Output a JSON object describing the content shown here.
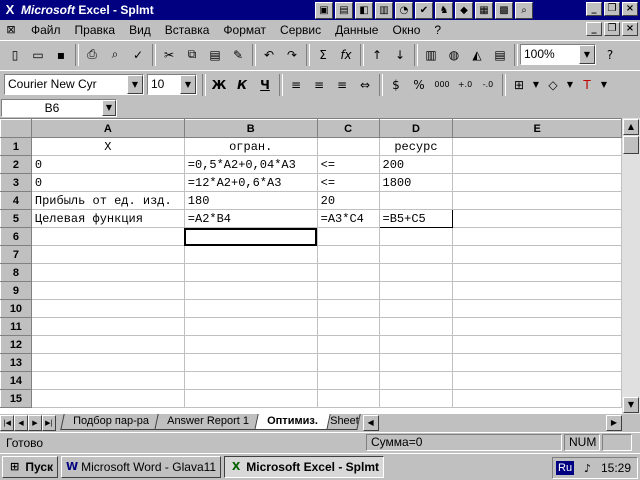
{
  "window": {
    "title_brand": "Microsoft",
    "title_rest": " Excel - Splmt",
    "app_icon": "excel-x-icon",
    "buttons": [
      "_",
      "❐",
      "×"
    ]
  },
  "menu": {
    "items": [
      "Файл",
      "Правка",
      "Вид",
      "Вставка",
      "Формат",
      "Сервис",
      "Данные",
      "Окно",
      "?"
    ]
  },
  "toolbar1": {
    "zoom": "100%"
  },
  "toolbar2": {
    "font_name": "Courier New Cyr",
    "font_size": "10",
    "bold": "Ж",
    "italic": "К",
    "underline": "Ч"
  },
  "formula_bar": {
    "name_box": "B6",
    "formula": ""
  },
  "sheet": {
    "columns": [
      "A",
      "B",
      "C",
      "D",
      "E"
    ],
    "rows": [
      {
        "n": "1",
        "cells": [
          "X",
          "огран.",
          "",
          "ресурс",
          ""
        ]
      },
      {
        "n": "2",
        "cells": [
          "0",
          "=0,5*A2+0,04*A3",
          "<=",
          "200",
          ""
        ]
      },
      {
        "n": "3",
        "cells": [
          "0",
          "=12*A2+0,6*A3",
          "<=",
          "1800",
          ""
        ]
      },
      {
        "n": "4",
        "cells": [
          "Прибыль от ед. изд.",
          "180",
          "20",
          "",
          ""
        ]
      },
      {
        "n": "5",
        "cells": [
          "Целевая функция",
          "=A2*B4",
          "=A3*C4",
          "=B5+C5",
          ""
        ]
      },
      {
        "n": "6",
        "cells": [
          "",
          "",
          "",
          "",
          ""
        ]
      },
      {
        "n": "7",
        "cells": [
          "",
          "",
          "",
          "",
          ""
        ]
      },
      {
        "n": "8",
        "cells": [
          "",
          "",
          "",
          "",
          ""
        ]
      },
      {
        "n": "9",
        "cells": [
          "",
          "",
          "",
          "",
          ""
        ]
      },
      {
        "n": "10",
        "cells": [
          "",
          "",
          "",
          "",
          ""
        ]
      },
      {
        "n": "11",
        "cells": [
          "",
          "",
          "",
          "",
          ""
        ]
      },
      {
        "n": "12",
        "cells": [
          "",
          "",
          "",
          "",
          ""
        ]
      },
      {
        "n": "13",
        "cells": [
          "",
          "",
          "",
          "",
          ""
        ]
      },
      {
        "n": "14",
        "cells": [
          "",
          "",
          "",
          "",
          ""
        ]
      },
      {
        "n": "15",
        "cells": [
          "",
          "",
          "",
          "",
          ""
        ]
      }
    ]
  },
  "tabs": [
    "Подбор пар-ра",
    "Answer Report 1",
    "Оптимиз.",
    "Sheet"
  ],
  "active_tab": 2,
  "status": {
    "ready": "Готово",
    "sum": "Сумма=0",
    "num": "NUM"
  },
  "taskbar": {
    "start": "Пуск",
    "tasks": [
      "Microsoft Word - Glava11",
      "Microsoft Excel - Splmt"
    ],
    "lang": "Ru",
    "clock": "15:29"
  }
}
